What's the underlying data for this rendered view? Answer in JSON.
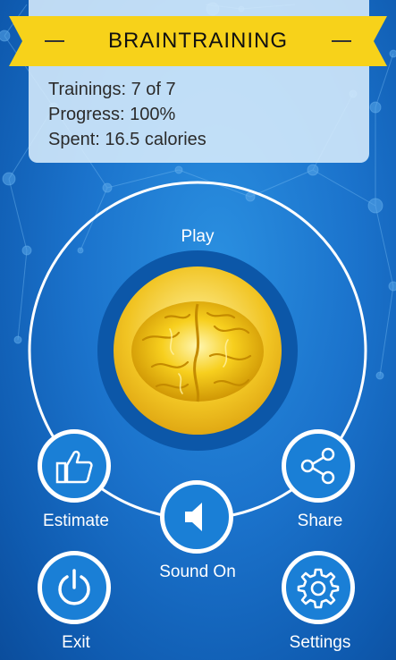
{
  "header": {
    "title": "BRAINTRAINING"
  },
  "stats": {
    "trainings": "Trainings: 7 of 7",
    "progress": "Progress: 100%",
    "spent": "Spent: 16.5 calories"
  },
  "play": {
    "label": "Play"
  },
  "buttons": {
    "estimate": "Estimate",
    "share": "Share",
    "sound": "Sound On",
    "exit": "Exit",
    "settings": "Settings"
  },
  "colors": {
    "ribbon": "#f7d21a",
    "background": "#1b73cc",
    "button": "#1a7fd6",
    "brain": "#f2c21a"
  },
  "icons": [
    "thumbs-up-icon",
    "share-icon",
    "speaker-icon",
    "power-icon",
    "gear-icon",
    "brain-icon"
  ]
}
